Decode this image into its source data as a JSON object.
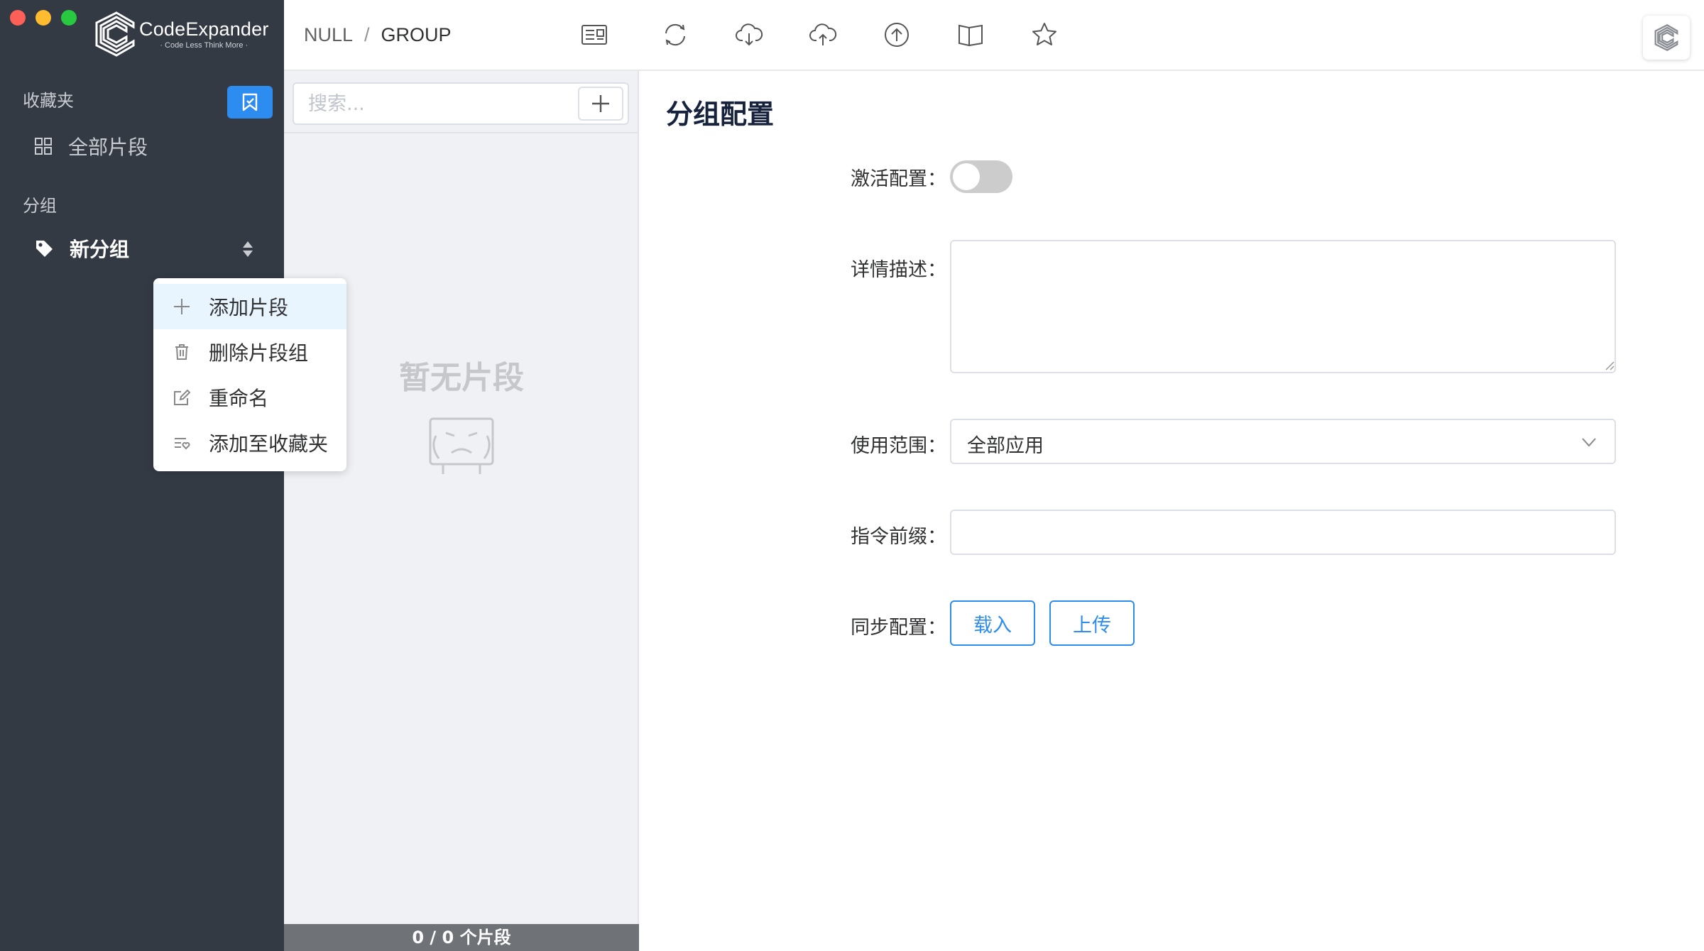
{
  "window": {
    "traffic_lights": [
      "close",
      "minimize",
      "zoom"
    ]
  },
  "brand": {
    "title": "CodeExpander",
    "subtitle": "· Code Less Think More ·"
  },
  "sidebar": {
    "favorites_label": "收藏夹",
    "all_snippets_label": "全部片段",
    "groups_label": "分组",
    "group_item_label": "新分组"
  },
  "breadcrumb": {
    "root": "NULL",
    "separator": "/",
    "current": "GROUP"
  },
  "toolbar": {
    "icons": [
      "details-icon",
      "sync-icon",
      "cloud-download-icon",
      "cloud-upload-icon",
      "upload-icon",
      "book-icon",
      "star-icon"
    ]
  },
  "list": {
    "search_placeholder": "搜索...",
    "empty_text": "暂无片段",
    "footer": "0 / 0 个片段"
  },
  "config": {
    "title": "分组配置",
    "activate_label": "激活配置：",
    "activate_on": false,
    "description_label": "详情描述：",
    "description_value": "",
    "scope_label": "使用范围：",
    "scope_value": "全部应用",
    "prefix_label": "指令前缀：",
    "prefix_value": "",
    "sync_label": "同步配置：",
    "load_button": "载入",
    "upload_button": "上传"
  },
  "context_menu": {
    "items": [
      {
        "label": "添加片段",
        "icon": "plus-icon"
      },
      {
        "label": "删除片段组",
        "icon": "trash-icon"
      },
      {
        "label": "重命名",
        "icon": "edit-icon"
      },
      {
        "label": "添加至收藏夹",
        "icon": "favorite-list-icon"
      }
    ]
  },
  "colors": {
    "sidebar_bg": "#343a44",
    "accent": "#2d8cf0",
    "list_bg": "#f0f1f4",
    "menu_hover": "#e8f4fe"
  }
}
